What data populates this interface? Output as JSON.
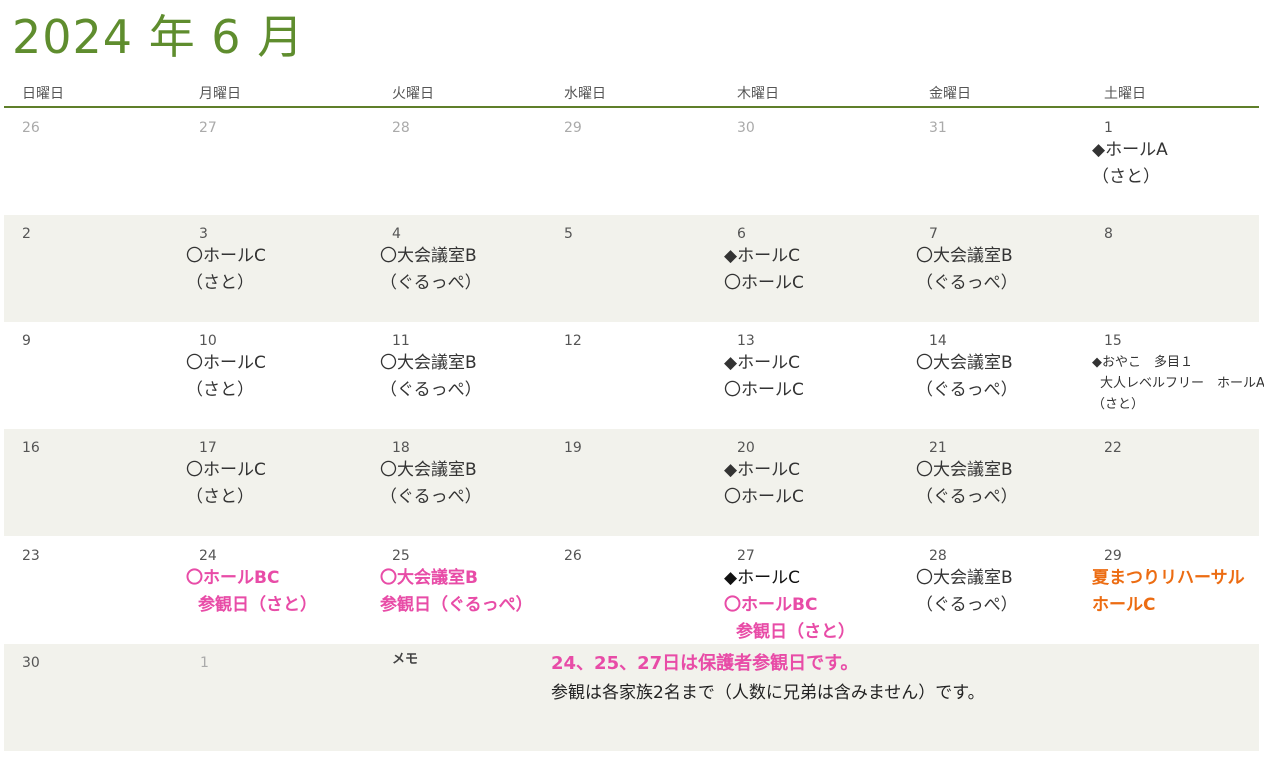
{
  "calendar": {
    "title": "2024 年 6 月",
    "weekdays": [
      "日曜日",
      "月曜日",
      "火曜日",
      "水曜日",
      "木曜日",
      "金曜日",
      "土曜日"
    ]
  },
  "weeks": [
    {
      "days": [
        {
          "num": "26",
          "muted": true,
          "events": []
        },
        {
          "num": "27",
          "muted": true,
          "events": []
        },
        {
          "num": "28",
          "muted": true,
          "events": []
        },
        {
          "num": "29",
          "muted": true,
          "events": []
        },
        {
          "num": "30",
          "muted": true,
          "events": []
        },
        {
          "num": "31",
          "muted": true,
          "events": []
        },
        {
          "num": "1",
          "muted": false,
          "events": [
            "◆ホールA",
            "（さと）"
          ]
        }
      ]
    },
    {
      "days": [
        {
          "num": "2",
          "events": []
        },
        {
          "num": "3",
          "events": [
            "〇ホールC",
            "（さと）"
          ]
        },
        {
          "num": "4",
          "events": [
            "〇大会議室B",
            "（ぐるっぺ）"
          ]
        },
        {
          "num": "5",
          "events": []
        },
        {
          "num": "6",
          "events": [
            "◆ホールC",
            "〇ホールC"
          ]
        },
        {
          "num": "7",
          "events": [
            "〇大会議室B",
            "（ぐるっぺ）"
          ]
        },
        {
          "num": "8",
          "events": []
        }
      ]
    },
    {
      "days": [
        {
          "num": "9",
          "events": []
        },
        {
          "num": "10",
          "events": [
            "〇ホールC",
            "（さと）"
          ]
        },
        {
          "num": "11",
          "events": [
            "〇大会議室B",
            "（ぐるっぺ）"
          ]
        },
        {
          "num": "12",
          "events": []
        },
        {
          "num": "13",
          "events": [
            "◆ホールC",
            "〇ホールC"
          ]
        },
        {
          "num": "14",
          "events": [
            "〇大会議室B",
            "（ぐるっぺ）"
          ]
        },
        {
          "num": "15",
          "small": true,
          "events": [
            "◆おやこ　多目１",
            "大人レベルフリー　ホールA",
            "（さと）"
          ]
        }
      ]
    },
    {
      "days": [
        {
          "num": "16",
          "events": []
        },
        {
          "num": "17",
          "events": [
            "〇ホールC",
            "（さと）"
          ]
        },
        {
          "num": "18",
          "events": [
            "〇大会議室B",
            "（ぐるっぺ）"
          ]
        },
        {
          "num": "19",
          "events": []
        },
        {
          "num": "20",
          "events": [
            "◆ホールC",
            "〇ホールC"
          ]
        },
        {
          "num": "21",
          "events": [
            "〇大会議室B",
            "（ぐるっぺ）"
          ]
        },
        {
          "num": "22",
          "events": []
        }
      ]
    },
    {
      "days": [
        {
          "num": "23",
          "events": []
        },
        {
          "num": "24",
          "color": "pink",
          "events": [
            "〇ホールBC",
            "参観日（さと）"
          ]
        },
        {
          "num": "25",
          "color": "pink",
          "events": [
            "〇大会議室B",
            "参観日（ぐるっぺ）"
          ]
        },
        {
          "num": "26",
          "events": []
        },
        {
          "num": "27",
          "mixed": true,
          "events": [
            "◆ホールC",
            "〇ホールBC",
            "参観日（さと）"
          ]
        },
        {
          "num": "28",
          "events": [
            "〇大会議室B",
            "（ぐるっぺ）"
          ]
        },
        {
          "num": "29",
          "color": "orange",
          "events": [
            "夏まつりリハーサル",
            "ホールC"
          ]
        }
      ]
    }
  ],
  "last_week": {
    "day30": "30",
    "next1": "1",
    "memo_label": "メモ",
    "memo_highlight": "24、25、27日は保護者参観日です。",
    "memo_text": "参観は各家族2名まで（人数に兄弟は含みません）です。"
  },
  "colors": {
    "title_green": "#5f8d2e",
    "row_shade": "#f2f2ec",
    "highlight_pink": "#e84ca7",
    "highlight_orange": "#ec6c12"
  }
}
